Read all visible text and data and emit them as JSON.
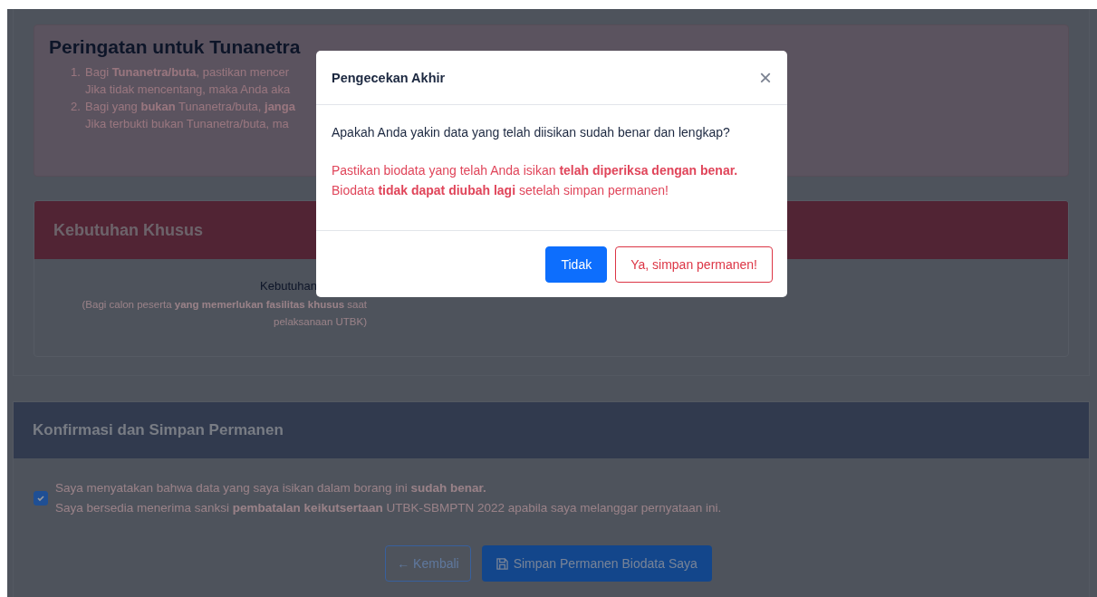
{
  "warning": {
    "title": "Peringatan untuk Tunanetra",
    "items": [
      {
        "number": "1.",
        "lines": [
          "Bagi **Tunanetra/buta**, pastikan mencer",
          "Jika tidak mencentang, maka Anda aka"
        ]
      },
      {
        "number": "2.",
        "lines": [
          "Bagi yang **bukan** Tunanetra/buta, **janga**",
          "Jika terbukti bukan Tunanetra/buta, ma"
        ]
      }
    ]
  },
  "special_needs": {
    "title": "Kebutuhan Khusus",
    "label": "Kebutuhan",
    "note": "(Bagi calon peserta **yang memerlukan fasilitas khusus** saat pelaksanaan UTBK)"
  },
  "confirmation": {
    "title": "Konfirmasi dan Simpan Permanen",
    "checked": true,
    "lines": [
      "Saya menyatakan bahwa data yang saya isikan dalam borang ini **sudah benar.**",
      "Saya bersedia menerima sanksi **pembatalan keikutsertaan** UTBK-SBMPTN 2022 apabila saya melanggar pernyataan ini."
    ],
    "back_button": "← Kembali",
    "save_button": "Simpan Permanen Biodata Saya"
  },
  "modal": {
    "title": "Pengecekan Akhir",
    "close": "×",
    "question": "Apakah Anda yakin data yang telah diisikan sudah benar dan lengkap?",
    "warning_lines": [
      "Pastikan biodata yang telah Anda isikan **telah diperiksa dengan benar.**",
      "Biodata **tidak dapat diubah lagi** setelah simpan permanen!"
    ],
    "buttons": [
      {
        "label": "Tidak",
        "kind": "primary"
      },
      {
        "label": "Ya, simpan permanen!",
        "kind": "danger-outline"
      }
    ]
  }
}
